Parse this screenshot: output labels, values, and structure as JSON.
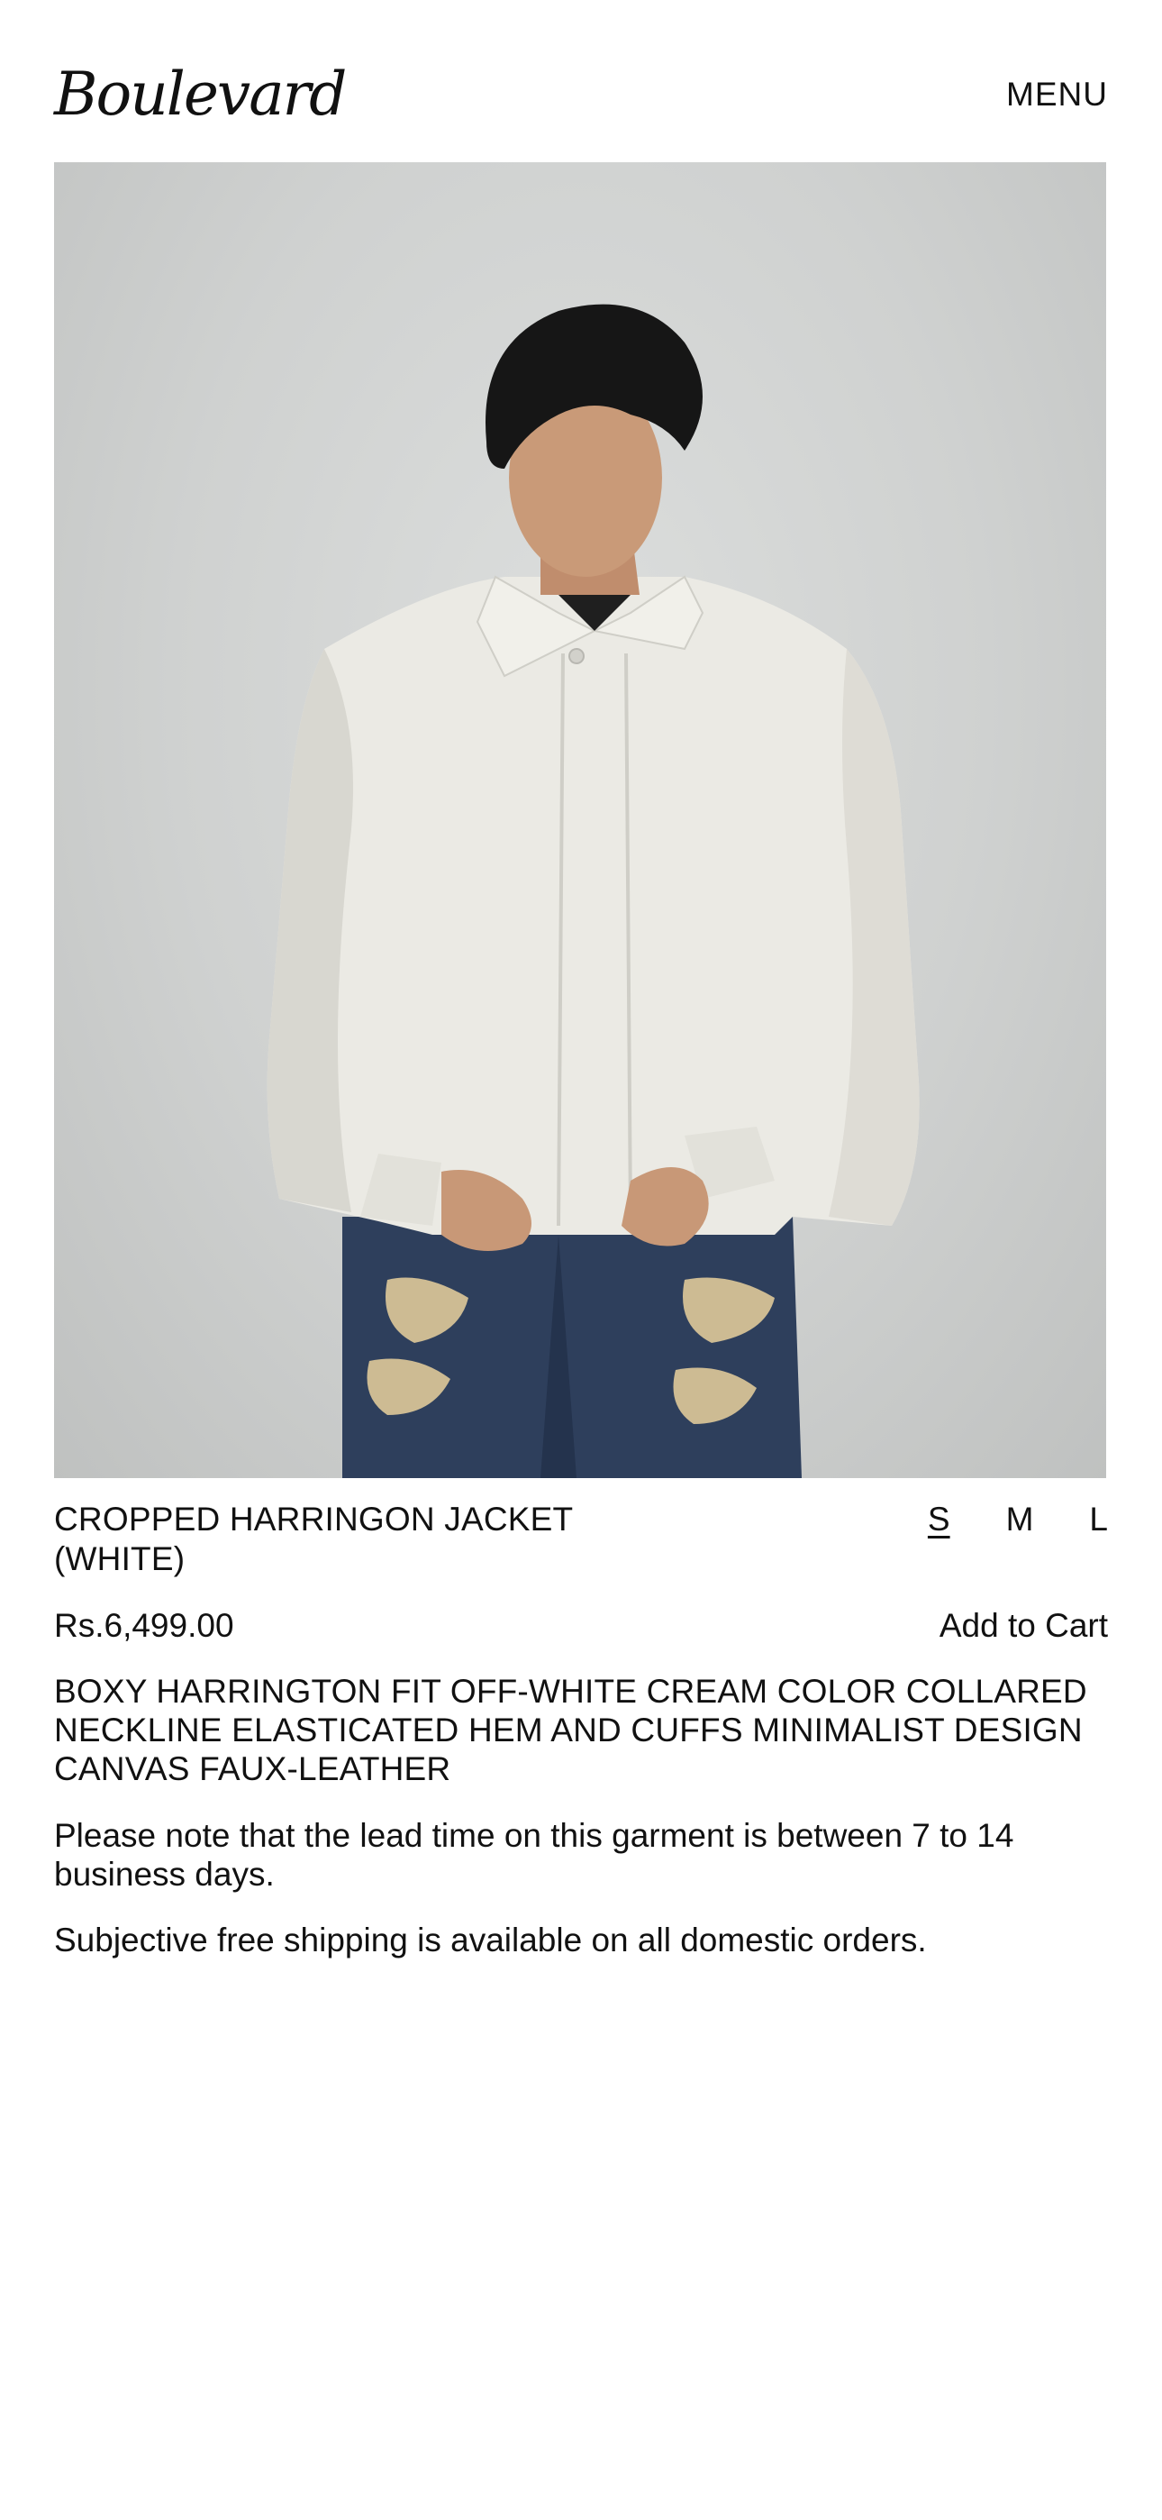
{
  "header": {
    "logo": "Boulevard",
    "menu_label": "MENU"
  },
  "product": {
    "title": "CROPPED HARRINGON JACKET (WHITE)",
    "sizes": [
      {
        "label": "S",
        "selected": true
      },
      {
        "label": "M",
        "selected": false
      },
      {
        "label": "L",
        "selected": false
      }
    ],
    "price": "Rs.6,499.00",
    "add_to_cart_label": "Add to Cart",
    "description": "BOXY HARRINGTON FIT OFF-WHITE CREAM COLOR COLLARED NECKLINE ELASTICATED HEM AND CUFFS MINIMALIST DESIGN CANVAS FAUX-LEATHER",
    "lead_time_note": "Please note that the lead time on this garment is between 7 to 14 business days.",
    "shipping_note": "Subjective free shipping is available on all domestic orders."
  },
  "colors": {
    "text": "#111111",
    "background": "#ffffff",
    "photo_background": "#d3d5d4",
    "jacket": "#ebeae4",
    "denim": "#2e3f5c"
  }
}
